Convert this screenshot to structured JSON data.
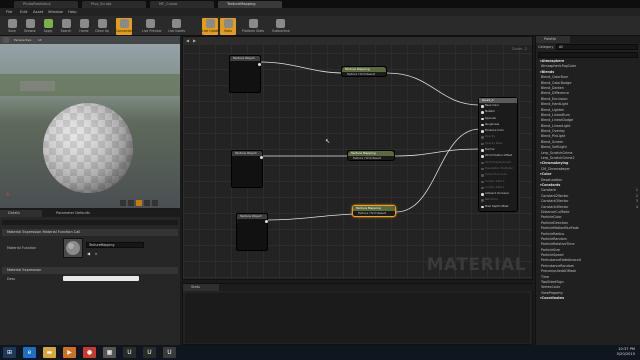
{
  "tabs": [
    {
      "label": "PhotoRealisticA",
      "active": false
    },
    {
      "label": "Plus_Sculpt",
      "active": false
    },
    {
      "label": "MF_Cursor",
      "active": false
    },
    {
      "label": "TextureMapping",
      "active": true
    }
  ],
  "menu": [
    "File",
    "Edit",
    "Asset",
    "Window",
    "Help"
  ],
  "toolbar": [
    {
      "label": "Save",
      "icon": "save-icon",
      "color": "#8a8a8a",
      "highlight": false
    },
    {
      "label": "Browse",
      "icon": "browse-icon",
      "color": "#8a8a8a",
      "highlight": false
    },
    {
      "label": "Apply",
      "icon": "apply-icon",
      "color": "#7bb04a",
      "highlight": false
    },
    {
      "label": "Search",
      "icon": "search-icon",
      "color": "#8a8a8a",
      "highlight": false
    },
    {
      "label": "Home",
      "icon": "home-icon",
      "color": "#8a8a8a",
      "highlight": false
    },
    {
      "label": "Clean Up",
      "icon": "clean-up-icon",
      "color": "#8a8a8a",
      "highlight": false
    },
    {
      "label": "Connectors",
      "icon": "connectors-icon",
      "color": "#8a8a8a",
      "highlight": true
    },
    {
      "label": "Live Preview",
      "icon": "live-preview-icon",
      "color": "#8a8a8a",
      "highlight": false
    },
    {
      "label": "Live Nodes",
      "icon": "live-nodes-icon",
      "color": "#8a8a8a",
      "highlight": false
    },
    {
      "label": "Live Update",
      "icon": "live-update-icon",
      "color": "#8a8a8a",
      "highlight": true
    },
    {
      "label": "Stats",
      "icon": "stats-icon",
      "color": "#8a8a8a",
      "highlight": true
    },
    {
      "label": "Platform Stats",
      "icon": "platform-stats-icon",
      "color": "#8a8a8a",
      "highlight": false
    },
    {
      "label": "Subtractive",
      "icon": "subtractive-icon",
      "color": "#8a8a8a",
      "highlight": false
    }
  ],
  "viewport": {
    "mode": "Perspective",
    "lit": "Lit"
  },
  "details": {
    "tabs": [
      "Details",
      "Parameter Defaults"
    ],
    "section1": "Material Expression Material Function Call",
    "field_label": "Material Function",
    "field_value": "TextureMapping",
    "section2": "Material Expression",
    "desc_label": "Desc"
  },
  "graph": {
    "zoom": "Zoom -2",
    "watermark": "MATERIAL",
    "texture_nodes": [
      {
        "title": "Texture Object"
      },
      {
        "title": "Texture Object"
      },
      {
        "title": "Texture Object"
      }
    ],
    "mapping_nodes": [
      {
        "title": "Texture Mapping",
        "pin": "Texture (T2d) Result"
      },
      {
        "title": "Texture Mapping",
        "pin": "Texture (T2d) Result"
      },
      {
        "title": "Texture Mapping",
        "pin": "Texture (T2d) Result"
      }
    ],
    "material_node": {
      "title": "Quad_A",
      "pins": [
        {
          "label": "Base Color",
          "active": true
        },
        {
          "label": "Metallic",
          "active": true
        },
        {
          "label": "Specular",
          "active": true
        },
        {
          "label": "Roughness",
          "active": true
        },
        {
          "label": "Emissive Color",
          "active": true
        },
        {
          "label": "Opacity",
          "active": false
        },
        {
          "label": "Opacity Mask",
          "active": false
        },
        {
          "label": "Normal",
          "active": true
        },
        {
          "label": "World Position Offset",
          "active": true
        },
        {
          "label": "World Displacement",
          "active": false
        },
        {
          "label": "Tessellation Multiplier",
          "active": false
        },
        {
          "label": "Subsurface Color",
          "active": false
        },
        {
          "label": "Custom Data 0",
          "active": false
        },
        {
          "label": "Custom Data 1",
          "active": false
        },
        {
          "label": "Ambient Occlusion",
          "active": true
        },
        {
          "label": "Refraction",
          "active": false
        },
        {
          "label": "Pixel Depth Offset",
          "active": true
        }
      ]
    }
  },
  "stats": {
    "tab": "Stats"
  },
  "palette": {
    "tab": "Palette",
    "category_label": "Category",
    "category_value": "All",
    "search_placeholder": "Search",
    "items": [
      {
        "text": "Atmosphere",
        "kind": "cat"
      },
      {
        "text": "AtmosphericFogColor",
        "kind": "item",
        "key": ""
      },
      {
        "text": "Blends",
        "kind": "cat"
      },
      {
        "text": "Blend_ColorBurn",
        "kind": "item",
        "key": ""
      },
      {
        "text": "Blend_ColorDodge",
        "kind": "item",
        "key": ""
      },
      {
        "text": "Blend_Darken",
        "kind": "item",
        "key": ""
      },
      {
        "text": "Blend_Difference",
        "kind": "item",
        "key": ""
      },
      {
        "text": "Blend_Exclusion",
        "kind": "item",
        "key": ""
      },
      {
        "text": "Blend_HardLight",
        "kind": "item",
        "key": ""
      },
      {
        "text": "Blend_Lighten",
        "kind": "item",
        "key": ""
      },
      {
        "text": "Blend_LinearBurn",
        "kind": "item",
        "key": ""
      },
      {
        "text": "Blend_LinearDodge",
        "kind": "item",
        "key": ""
      },
      {
        "text": "Blend_LinearLight",
        "kind": "item",
        "key": ""
      },
      {
        "text": "Blend_Overlay",
        "kind": "item",
        "key": ""
      },
      {
        "text": "Blend_PinLight",
        "kind": "item",
        "key": ""
      },
      {
        "text": "Blend_Screen",
        "kind": "item",
        "key": ""
      },
      {
        "text": "Blend_SoftLight",
        "kind": "item",
        "key": ""
      },
      {
        "text": "Lerp_ScratchGrime",
        "kind": "item",
        "key": ""
      },
      {
        "text": "Lerp_ScratchGrime2",
        "kind": "item",
        "key": ""
      },
      {
        "text": "Chromakeying",
        "kind": "cat"
      },
      {
        "text": "CM_Chromakeyer",
        "kind": "item",
        "key": ""
      },
      {
        "text": "Color",
        "kind": "cat"
      },
      {
        "text": "Desaturation",
        "kind": "item",
        "key": ""
      },
      {
        "text": "Constants",
        "kind": "cat"
      },
      {
        "text": "Constant",
        "kind": "item",
        "key": "1"
      },
      {
        "text": "Constant2Vector",
        "kind": "item",
        "key": "2"
      },
      {
        "text": "Constant3Vector",
        "kind": "item",
        "key": "3"
      },
      {
        "text": "Constant4Vector",
        "kind": "item",
        "key": "4"
      },
      {
        "text": "DistanceCullFade",
        "kind": "item",
        "key": ""
      },
      {
        "text": "ParticleColor",
        "kind": "item",
        "key": ""
      },
      {
        "text": "ParticleDirection",
        "kind": "item",
        "key": ""
      },
      {
        "text": "ParticleMotionBlurFade",
        "kind": "item",
        "key": ""
      },
      {
        "text": "ParticleRadius",
        "kind": "item",
        "key": ""
      },
      {
        "text": "ParticleRandom",
        "kind": "item",
        "key": ""
      },
      {
        "text": "ParticleRelativeTime",
        "kind": "item",
        "key": ""
      },
      {
        "text": "ParticleSize",
        "kind": "item",
        "key": ""
      },
      {
        "text": "ParticleSpeed",
        "kind": "item",
        "key": ""
      },
      {
        "text": "PerInstanceFadeAmount",
        "kind": "item",
        "key": ""
      },
      {
        "text": "PerInstanceRandom",
        "kind": "item",
        "key": ""
      },
      {
        "text": "PrecomputedAOMask",
        "kind": "item",
        "key": ""
      },
      {
        "text": "Time",
        "kind": "item",
        "key": ""
      },
      {
        "text": "TwoSidedSign",
        "kind": "item",
        "key": ""
      },
      {
        "text": "VertexColor",
        "kind": "item",
        "key": ""
      },
      {
        "text": "ViewProperty",
        "kind": "item",
        "key": ""
      },
      {
        "text": "Coordinates",
        "kind": "cat"
      }
    ]
  },
  "taskbar": {
    "apps": [
      {
        "icon": "windows-start-icon",
        "glyph": "⊞",
        "color": "#1b3a5a"
      },
      {
        "icon": "ie-icon",
        "glyph": "e",
        "color": "#1f6fc0"
      },
      {
        "icon": "folder-icon",
        "glyph": "▬",
        "color": "#d8a53a"
      },
      {
        "icon": "media-icon",
        "glyph": "▶",
        "color": "#d0701e"
      },
      {
        "icon": "chrome-icon",
        "glyph": "●",
        "color": "#c93a2b"
      },
      {
        "icon": "film-icon",
        "glyph": "▦",
        "color": "#555555"
      },
      {
        "icon": "unreal-icon",
        "glyph": "U",
        "color": "#2a2a2a"
      },
      {
        "icon": "unreal-icon",
        "glyph": "U",
        "color": "#2a2a2a"
      },
      {
        "icon": "unreal-editor-icon",
        "glyph": "U",
        "color": "#3a3a3a"
      }
    ],
    "time": "10:37 PM",
    "date": "5/20/2015"
  },
  "colors": {
    "accent": "#e39d1c",
    "wire": "#e0e0e0",
    "graph_bg": "#232323"
  }
}
